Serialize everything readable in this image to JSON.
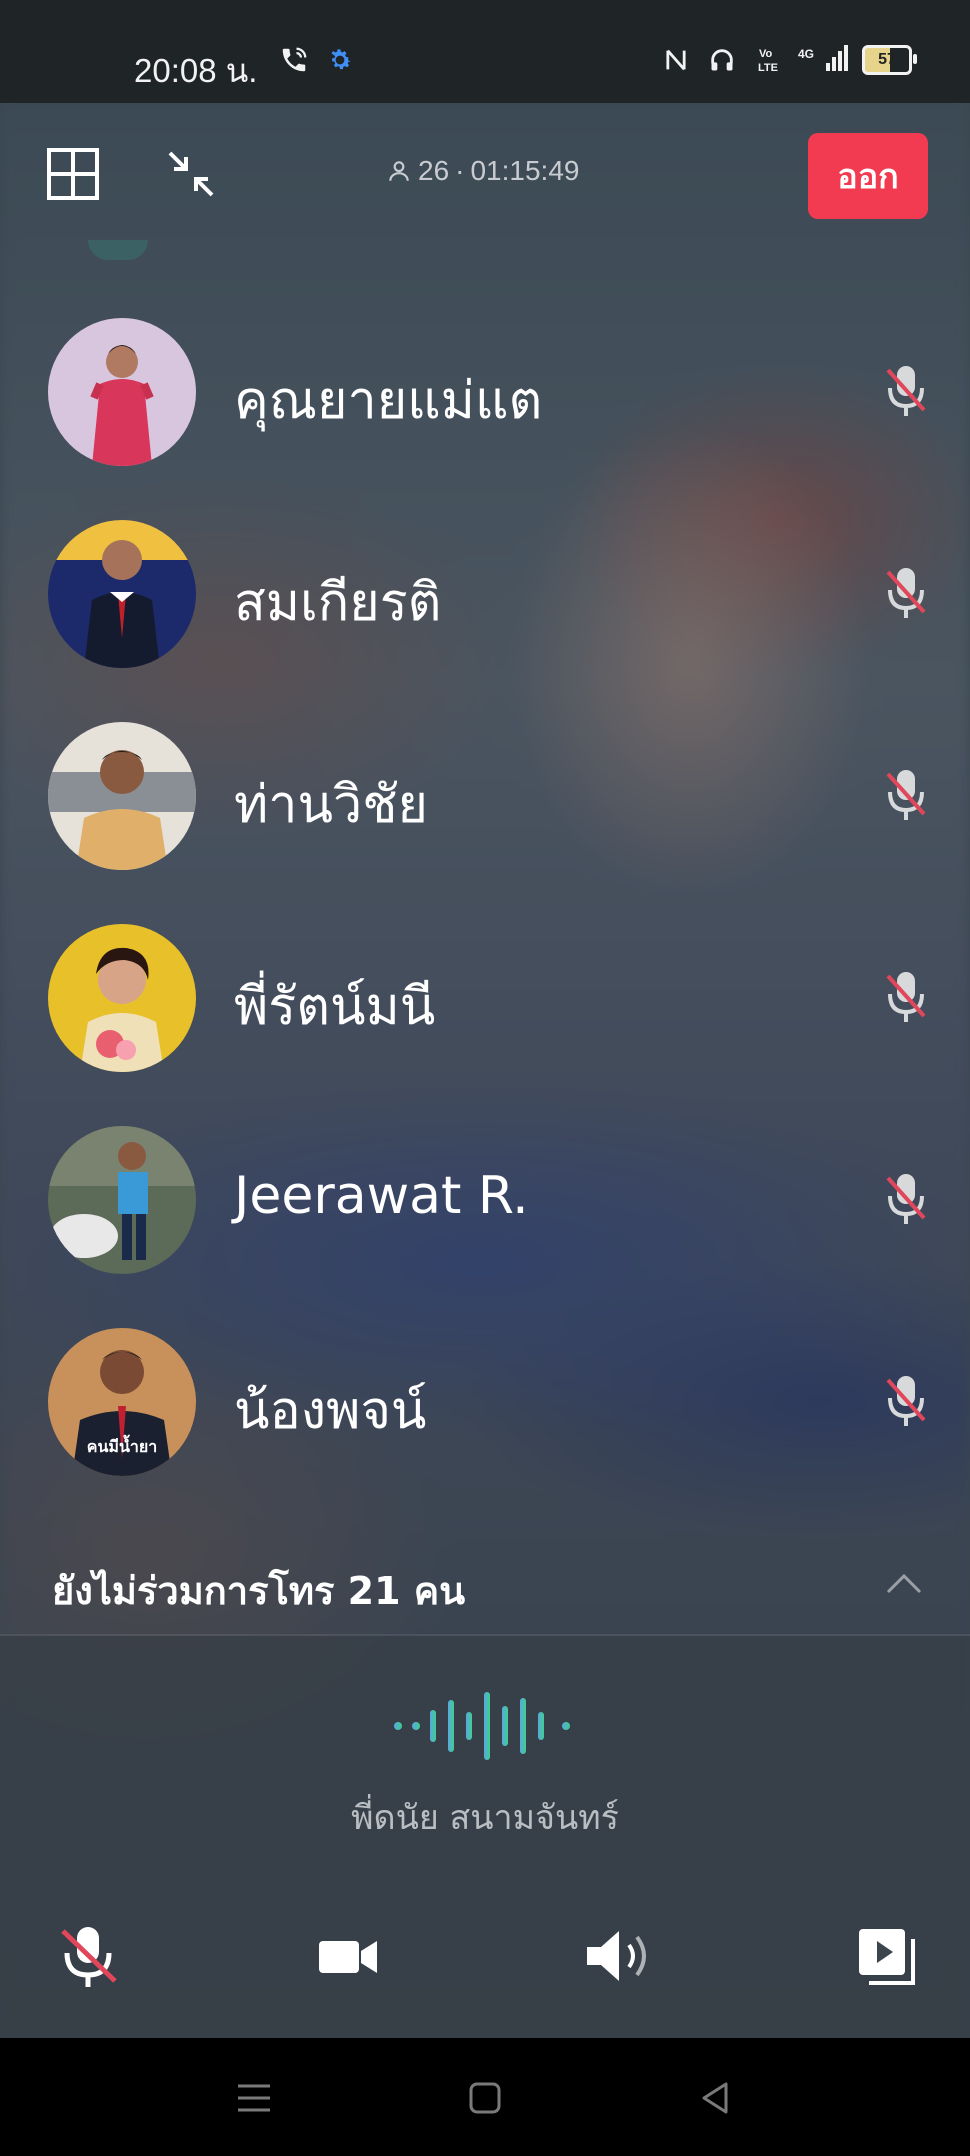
{
  "status_bar": {
    "time": "20:08 น.",
    "battery": "57",
    "network": "4G"
  },
  "call": {
    "participant_count": "26",
    "duration": "01:15:49",
    "leave_label": "ออก"
  },
  "participants": [
    {
      "name": "คุณยายแม่แต",
      "muted": true
    },
    {
      "name": "สมเกียรติ",
      "muted": true
    },
    {
      "name": "ท่านวิชัย",
      "muted": true
    },
    {
      "name": "พี่รัตน์มนี",
      "muted": true
    },
    {
      "name": "Jeerawat R.",
      "muted": true
    },
    {
      "name": "น้องพจน์",
      "muted": true
    }
  ],
  "not_joined": {
    "label": "ยังไม่ร่วมการโทร 21 คน"
  },
  "active_speaker": {
    "name": "พี่ดนัย สนามจันทร์"
  },
  "avatar_caption": "คนมีน้ำยา",
  "colors": {
    "leave": "#f23a50",
    "wave_start": "#5aa7e0",
    "wave_end": "#3ecf8e",
    "mute_slash": "#e0475a"
  }
}
